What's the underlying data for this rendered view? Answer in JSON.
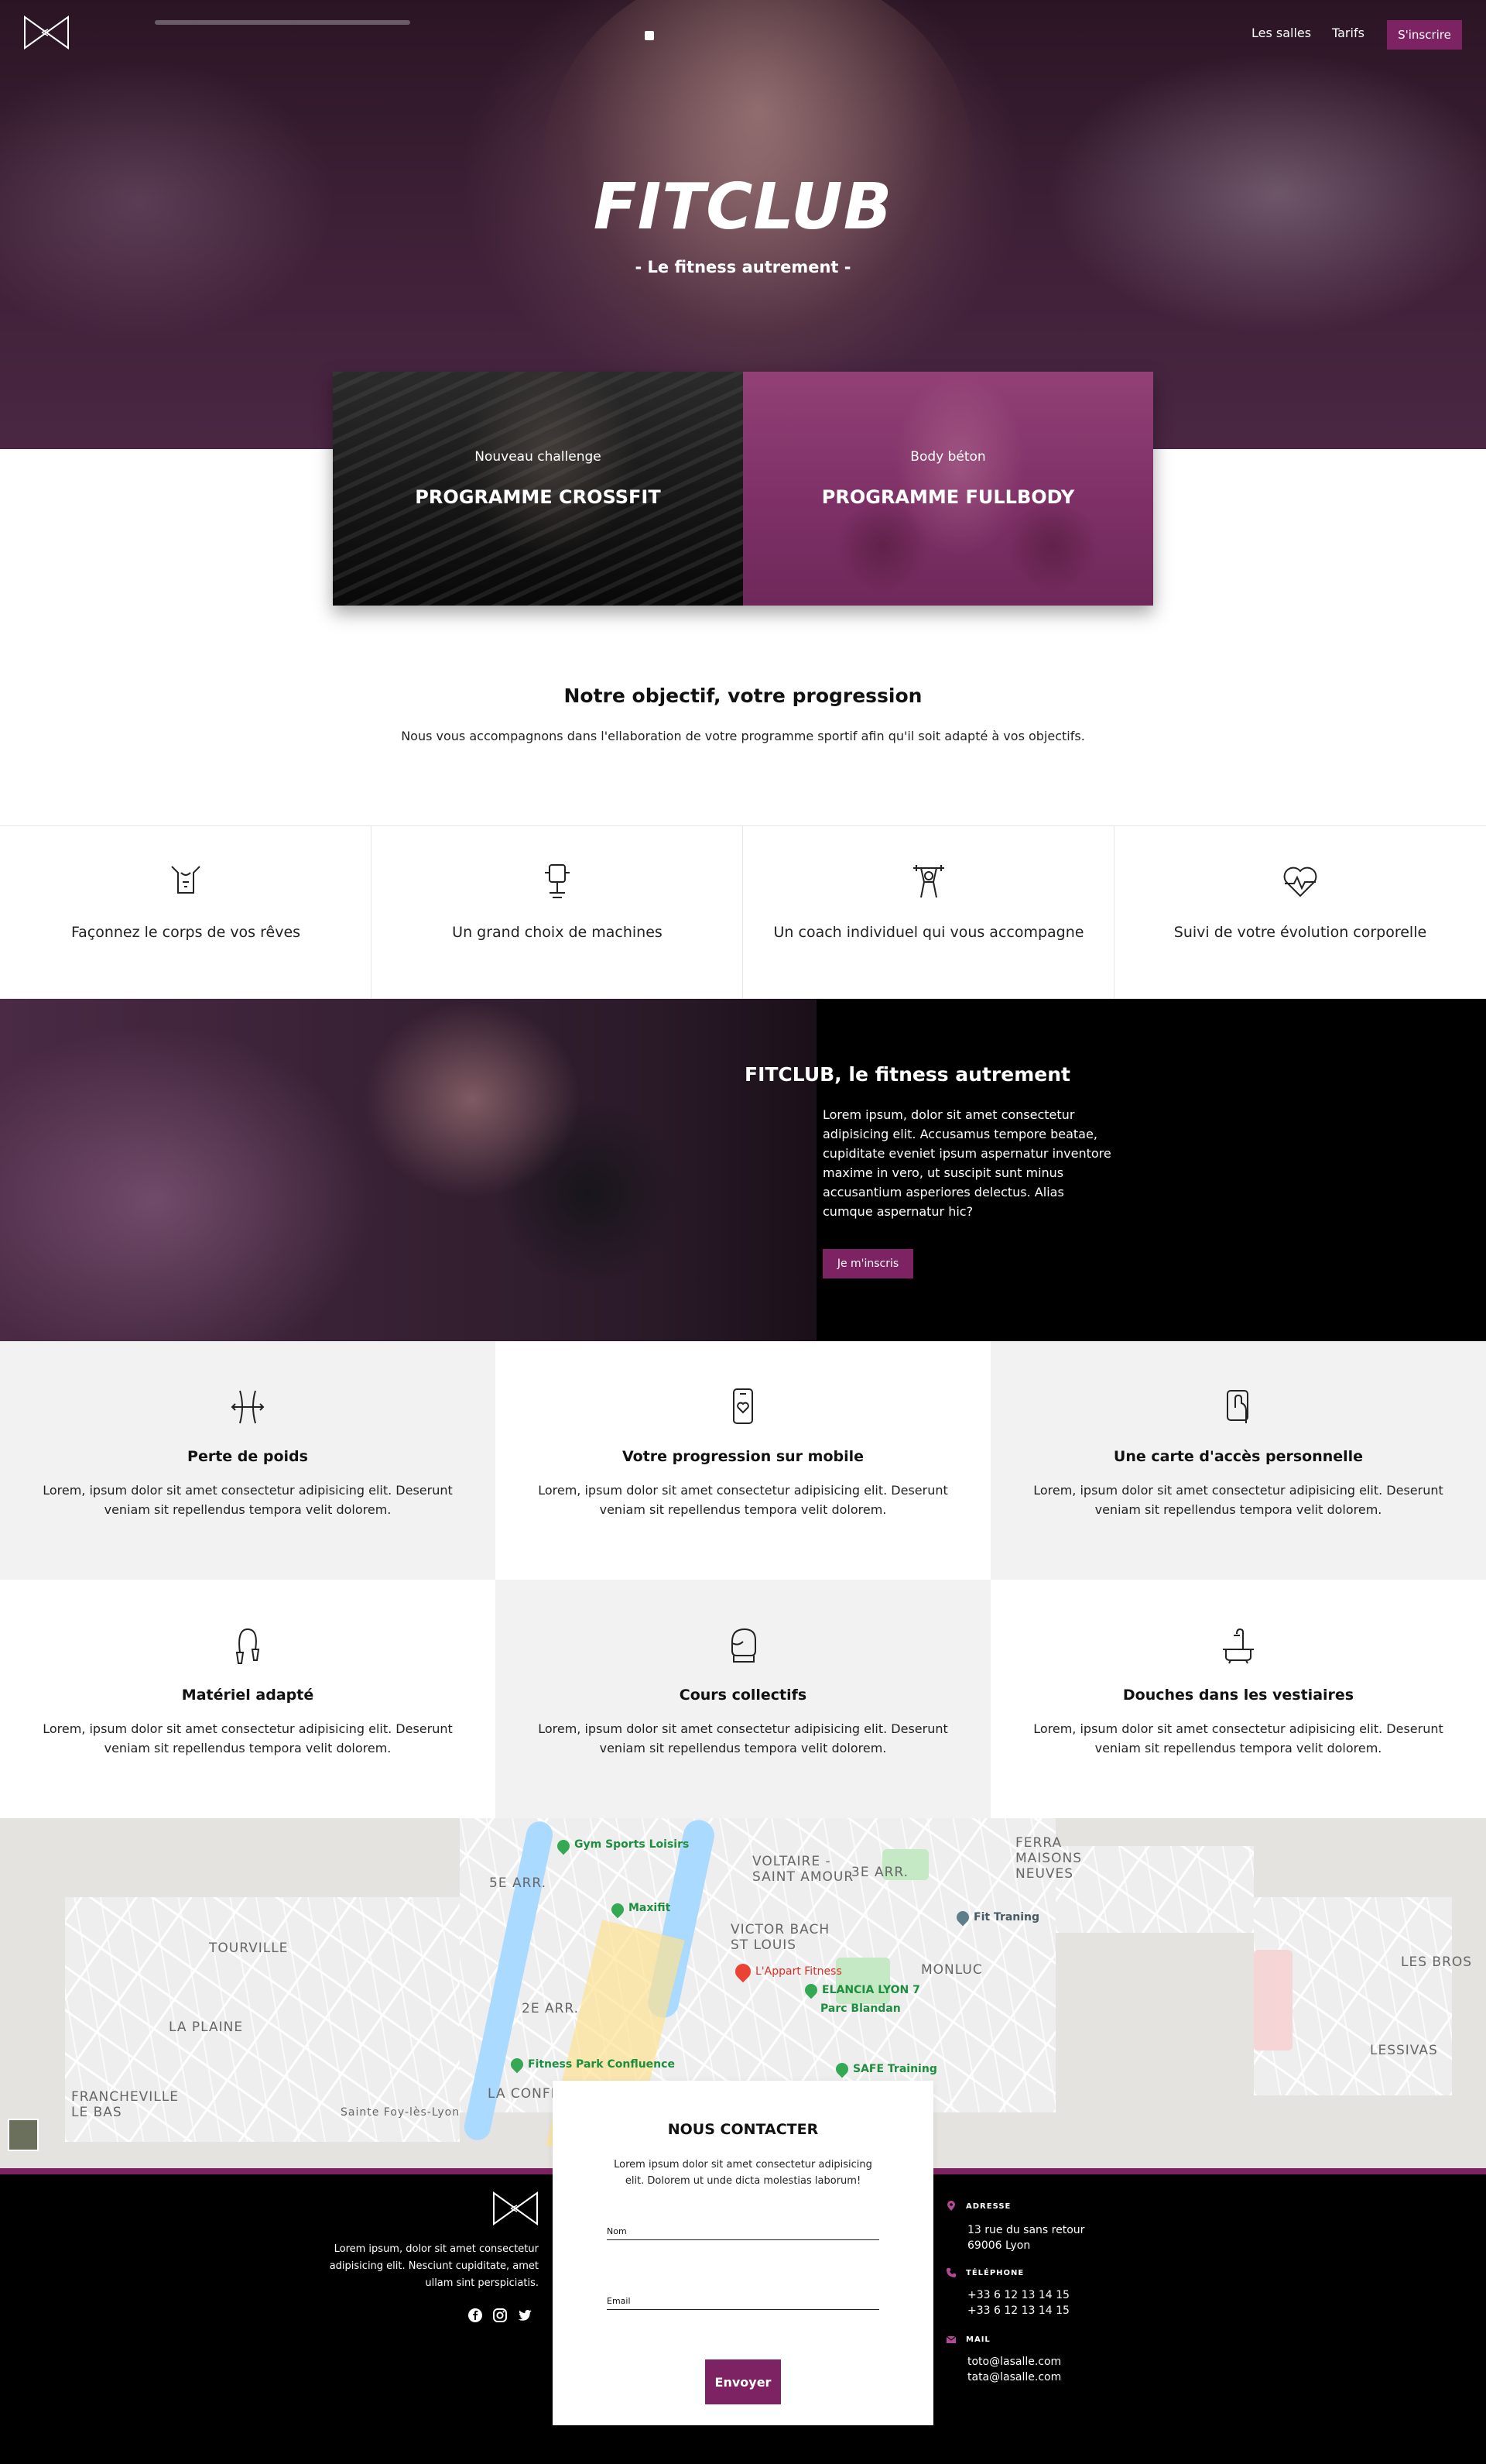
{
  "header": {
    "nav": {
      "salles": "Les salles",
      "tarifs": "Tarifs",
      "inscrire": "S'inscrire"
    }
  },
  "hero": {
    "title": "FITCLUB",
    "subtitle": "- Le fitness autrement -"
  },
  "programs": [
    {
      "kicker": "Nouveau challenge",
      "title": "PROGRAMME CROSSFIT"
    },
    {
      "kicker": "Body béton",
      "title": "PROGRAMME FULLBODY"
    }
  ],
  "objective": {
    "title": "Notre objectif, votre progression",
    "text": "Nous vous accompagnons dans l'ellaboration de votre programme sportif afin qu'il soit adapté à vos objectifs."
  },
  "features": [
    {
      "label": "Façonnez le corps de vos rêves",
      "icon": "body-icon"
    },
    {
      "label": "Un grand choix de machines",
      "icon": "machine-icon"
    },
    {
      "label": "Un coach individuel qui vous accompagne",
      "icon": "coach-icon"
    },
    {
      "label": "Suivi de votre évolution corporelle",
      "icon": "heartbeat-icon"
    }
  ],
  "promo": {
    "title": "FITCLUB, le fitness autrement",
    "text": "Lorem ipsum, dolor sit amet consectetur adipisicing elit. Accusamus tempore beatae, cupiditate eveniet ipsum aspernatur inventore maxime in vero, ut suscipit sunt minus accusantium asperiores delectus. Alias cumque aspernatur hic?",
    "button": "Je m'inscris"
  },
  "services": [
    {
      "title": "Perte de poids",
      "text": "Lorem, ipsum dolor sit amet consectetur adipisicing elit. Deserunt veniam sit repellendus tempora velit dolorem.",
      "icon": "waist-icon"
    },
    {
      "title": "Votre progression sur mobile",
      "text": "Lorem, ipsum dolor sit amet consectetur adipisicing elit. Deserunt veniam sit repellendus tempora velit dolorem.",
      "icon": "mobile-icon"
    },
    {
      "title": "Une carte d'accès personnelle",
      "text": "Lorem, ipsum dolor sit amet consectetur adipisicing elit. Deserunt veniam sit repellendus tempora velit dolorem.",
      "icon": "access-card-icon"
    },
    {
      "title": "Matériel adapté",
      "text": "Lorem, ipsum dolor sit amet consectetur adipisicing elit. Deserunt veniam sit repellendus tempora velit dolorem.",
      "icon": "jump-rope-icon"
    },
    {
      "title": "Cours collectifs",
      "text": "Lorem, ipsum dolor sit amet consectetur adipisicing elit. Deserunt veniam sit repellendus tempora velit dolorem.",
      "icon": "boxing-glove-icon"
    },
    {
      "title": "Douches dans les vestiaires",
      "text": "Lorem, ipsum dolor sit amet consectetur adipisicing elit. Deserunt veniam sit repellendus tempora velit dolorem.",
      "icon": "shower-icon"
    }
  ],
  "map": {
    "labels": [
      "5E ARR.",
      "VOLTAIRE -",
      "SAINT AMOUR",
      "3E ARR.",
      "FERRA",
      "MAISONS",
      "NEUVES",
      "VICTOR BACH",
      "ST LOUIS",
      "MONLUC",
      "TOURVILLE",
      "LA PLAINE",
      "2E ARR.",
      "LA CONFLUEN",
      "FRANCHEVILLE",
      "LE BAS",
      "LES BROS",
      "LESSIVAS",
      "Sainte Foy-lès-Lyon"
    ],
    "pois": [
      "Gym Sports Loisirs",
      "Maxifit",
      "L'Appart Fitness",
      "ELANCIA LYON 7",
      "Parc Blandan",
      "Fit Traning",
      "Fitness Park Confluence",
      "SAFE Training"
    ]
  },
  "contact": {
    "title": "NOUS CONTACTER",
    "text": "Lorem ipsum dolor sit amet consectetur adipisicing elit. Dolorem ut unde dicta molestias laborum!",
    "name_placeholder": "Nom",
    "email_placeholder": "Email",
    "send": "Envoyer"
  },
  "footer": {
    "about": "Lorem ipsum, dolor sit amet consectetur adipisicing elit. Nesciunt cupiditate, amet ullam sint perspiciatis.",
    "social": [
      "facebook-icon",
      "instagram-icon",
      "twitter-icon"
    ],
    "address_label": "ADRESSE",
    "address_line1": "13 rue du sans retour",
    "address_line2": "69006 Lyon",
    "phone_label": "TÉLÉPHONE",
    "phone1": "+33 6 12 13 14 15",
    "phone2": "+33 6 12 13 14 15",
    "mail_label": "MAIL",
    "mail1": "toto@lasalle.com",
    "mail2": "tata@lasalle.com"
  },
  "colors": {
    "accent": "#7d2364",
    "dark": "#000000",
    "light_grey": "#f2f2f2"
  }
}
